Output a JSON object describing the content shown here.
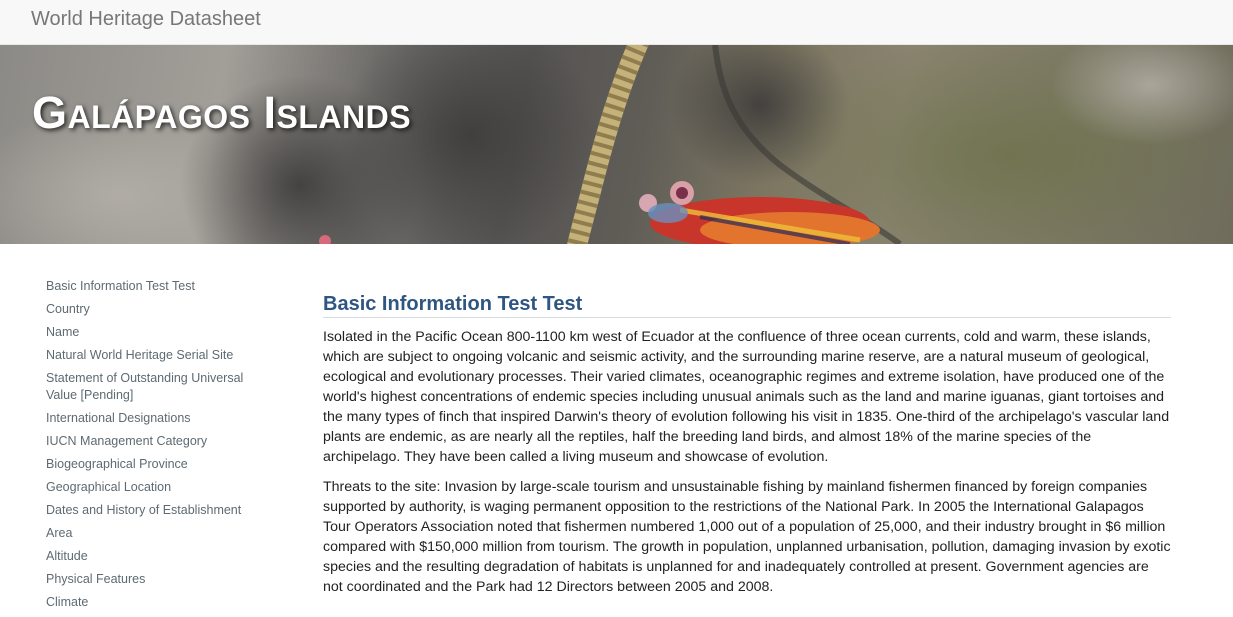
{
  "navbar": {
    "brand": "World Heritage Datasheet"
  },
  "hero": {
    "title": "Galápagos Islands"
  },
  "sidebar": {
    "items": [
      {
        "label": "Basic Information Test Test"
      },
      {
        "label": "Country"
      },
      {
        "label": "Name"
      },
      {
        "label": "Natural World Heritage Serial Site"
      },
      {
        "label": "Statement of Outstanding Universal Value [Pending]"
      },
      {
        "label": "International Designations"
      },
      {
        "label": "IUCN Management Category"
      },
      {
        "label": "Biogeographical Province"
      },
      {
        "label": "Geographical Location"
      },
      {
        "label": "Dates and History of Establishment"
      },
      {
        "label": "Area"
      },
      {
        "label": "Altitude"
      },
      {
        "label": "Physical Features"
      },
      {
        "label": "Climate"
      }
    ]
  },
  "main": {
    "section_title": "Basic Information Test Test",
    "paragraphs": [
      "Isolated in the Pacific Ocean 800-1100 km west of Ecuador at the confluence of three ocean currents, cold and warm, these islands, which are subject to ongoing volcanic and seismic activity, and the surrounding marine reserve, are a natural museum of geological, ecological and evolutionary processes. Their varied climates, oceanographic regimes and extreme isolation, have produced one of the world's highest concentrations of endemic species including unusual animals such as the land and marine iguanas, giant tortoises and the many types of finch that inspired Darwin's theory of evolution following his visit in 1835. One-third of the archipelago's vascular land plants are endemic, as are nearly all the reptiles, half the breeding land birds, and almost 18% of the marine species of the archipelago. They have been called a living museum and showcase of evolution.",
      "Threats to the site: Invasion by large-scale tourism and unsustainable fishing by mainland fishermen financed by foreign companies supported by authority, is waging permanent opposition to the restrictions of the National Park. In 2005 the International Galapagos Tour Operators Association noted that fishermen numbered 1,000 out of a population of 25,000, and their industry brought in $6 million compared with $150,000 million from tourism. The growth in population, unplanned urbanisation, pollution, damaging invasion by exotic species and the resulting degradation of habitats is unplanned for and inadequately controlled at present. Government agencies are not coordinated and the Park had 12 Directors between 2005 and 2008."
    ]
  }
}
